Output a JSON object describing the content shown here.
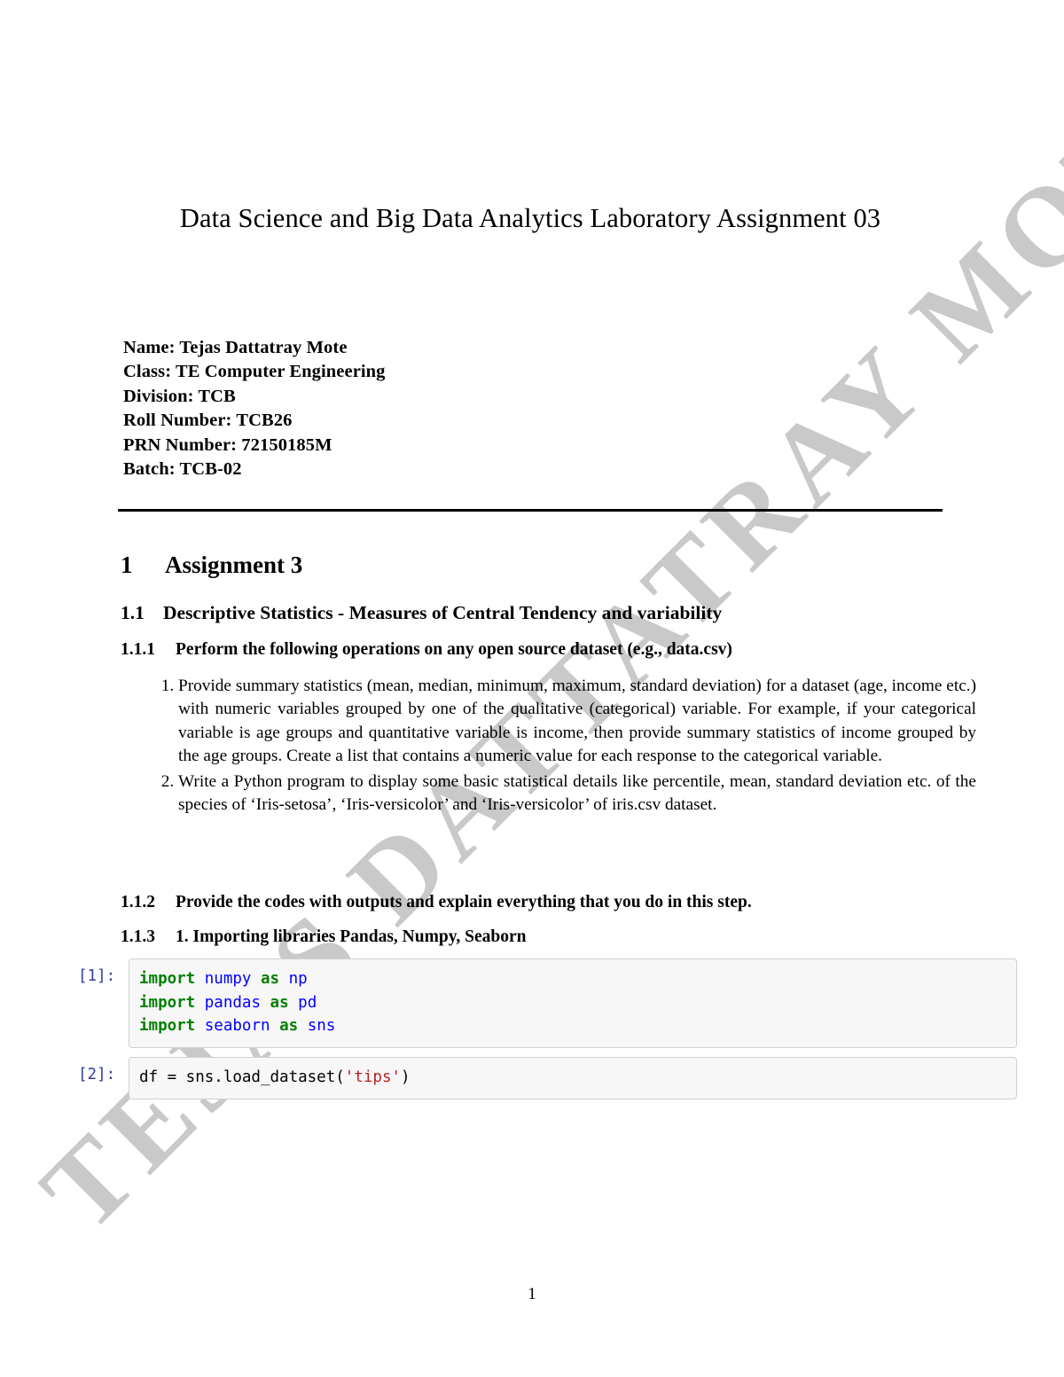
{
  "document": {
    "title": "Data Science and Big Data Analytics Laboratory Assignment 03",
    "page_number": "1",
    "watermark": "TEJAS DATTATRAY MOTE",
    "watermark_color": "#c9c9c9"
  },
  "meta": {
    "name": "Name: Tejas Dattatray Mote",
    "class": "Class: TE Computer Engineering",
    "division": "Division: TCB",
    "roll_number": "Roll Number: TCB26",
    "prn_number": "PRN Number: 72150185M",
    "batch": "Batch: TCB-02"
  },
  "sections": {
    "s1": {
      "number": "1",
      "title": "Assignment 3"
    },
    "s1_1": {
      "number": "1.1",
      "title": "Descriptive Statistics - Measures of Central Tendency and variability"
    },
    "s1_1_1": {
      "number": "1.1.1",
      "title": "Perform the following operations on any open source dataset (e.g., data.csv)"
    },
    "s1_1_2": {
      "number": "1.1.2",
      "title": "Provide the codes with outputs and explain everything that you do in this step."
    },
    "s1_1_3": {
      "number": "1.1.3",
      "title": "1. Importing libraries Pandas, Numpy, Seaborn"
    }
  },
  "list_items": [
    "Provide summary statistics (mean, median, minimum, maximum, standard deviation) for a dataset (age, income etc.) with numeric variables grouped by one of the qualitative (categorical) variable. For example, if your categorical variable is age groups and quantitative variable is income, then provide summary statistics of income grouped by the age groups. Create a list that contains a numeric value for each response to the categorical variable.",
    "Write a Python program to display some basic statistical details like percentile, mean, standard deviation etc.  of the species of ‘Iris-setosa’, ‘Iris-versicolor’ and ‘Iris-versicolor’ of iris.csv dataset."
  ],
  "code_cells": [
    {
      "prompt": "[1]:",
      "source": "import numpy as np\nimport pandas as pd\nimport seaborn as sns",
      "tokens": [
        [
          {
            "t": "import",
            "c": "kw"
          },
          {
            "t": " ",
            "c": "plain"
          },
          {
            "t": "numpy",
            "c": "name"
          },
          {
            "t": " ",
            "c": "plain"
          },
          {
            "t": "as",
            "c": "kw"
          },
          {
            "t": " ",
            "c": "plain"
          },
          {
            "t": "np",
            "c": "name"
          }
        ],
        [
          {
            "t": "import",
            "c": "kw"
          },
          {
            "t": " ",
            "c": "plain"
          },
          {
            "t": "pandas",
            "c": "name"
          },
          {
            "t": " ",
            "c": "plain"
          },
          {
            "t": "as",
            "c": "kw"
          },
          {
            "t": " ",
            "c": "plain"
          },
          {
            "t": "pd",
            "c": "name"
          }
        ],
        [
          {
            "t": "import",
            "c": "kw"
          },
          {
            "t": " ",
            "c": "plain"
          },
          {
            "t": "seaborn",
            "c": "name"
          },
          {
            "t": " ",
            "c": "plain"
          },
          {
            "t": "as",
            "c": "kw"
          },
          {
            "t": " ",
            "c": "plain"
          },
          {
            "t": "sns",
            "c": "name"
          }
        ]
      ]
    },
    {
      "prompt": "[2]:",
      "source": "df = sns.load_dataset('tips')",
      "tokens": [
        [
          {
            "t": "df = sns.load_dataset(",
            "c": "plain"
          },
          {
            "t": "'tips'",
            "c": "str"
          },
          {
            "t": ")",
            "c": "plain"
          }
        ]
      ]
    }
  ],
  "syntax_colors": {
    "keyword": "#008000",
    "name": "#0000ff",
    "string": "#ba2121",
    "prompt": "#303f9f",
    "cell_background": "#f7f7f7",
    "cell_border": "#cfcfcf"
  }
}
